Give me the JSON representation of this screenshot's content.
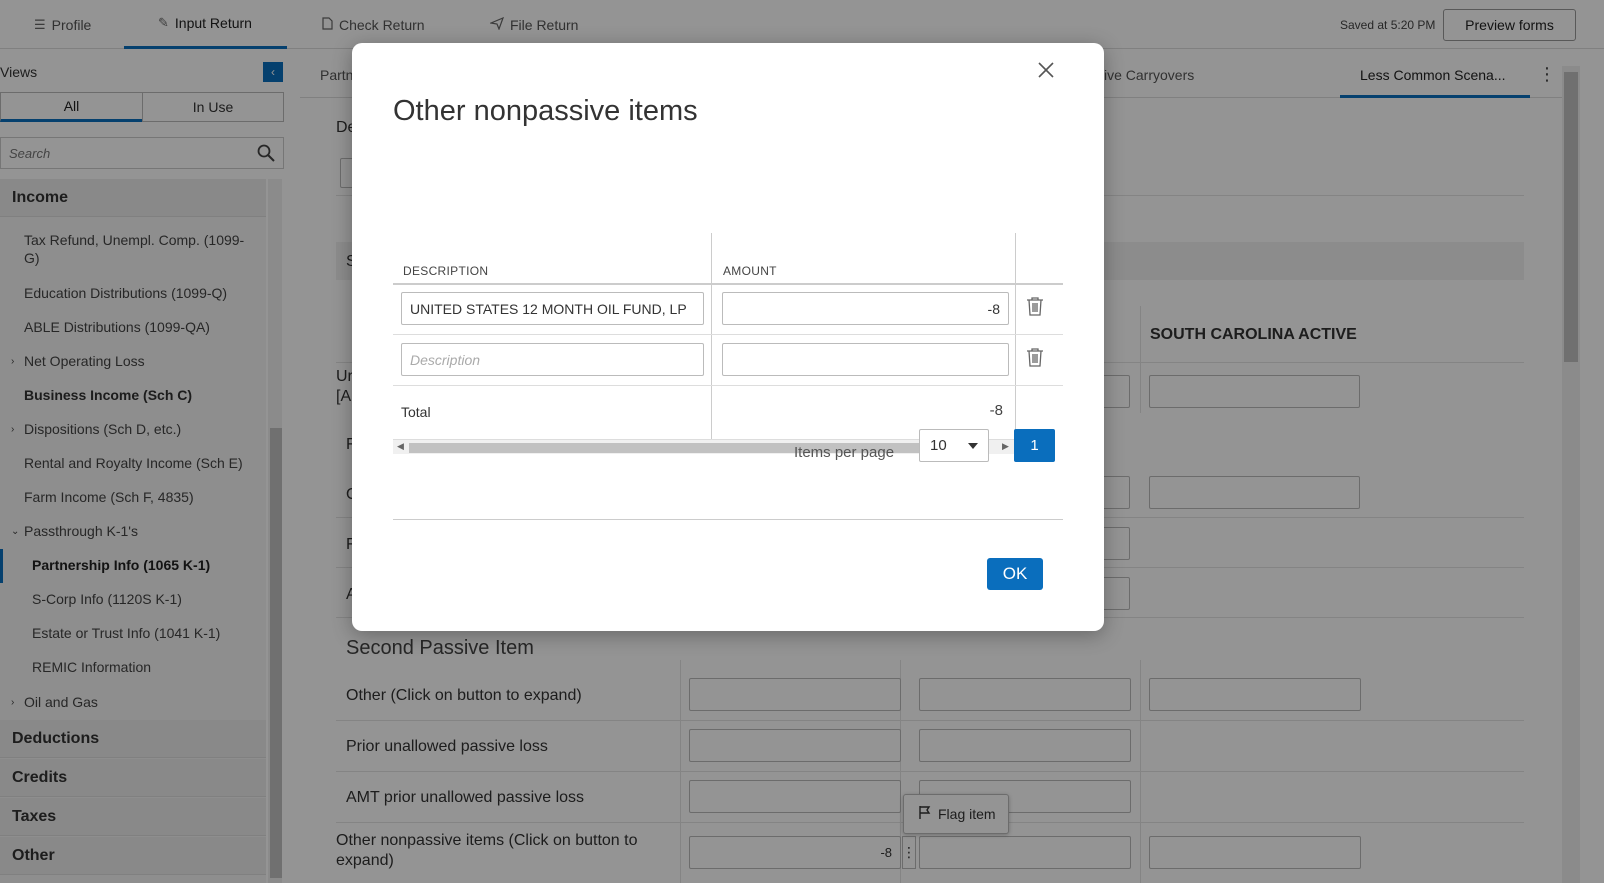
{
  "topnav": {
    "tabs": [
      {
        "label": "Profile",
        "icon": "list-icon"
      },
      {
        "label": "Input Return",
        "icon": "pencil-icon"
      },
      {
        "label": "Check Return",
        "icon": "document-icon"
      },
      {
        "label": "File Return",
        "icon": "paper-plane-icon"
      }
    ],
    "saved_text": "Saved at 5:20 PM",
    "preview_label": "Preview forms"
  },
  "sidebar": {
    "views_label": "Views",
    "filter_all": "All",
    "filter_in_use": "In Use",
    "search_placeholder": "Search",
    "categories": {
      "income": "Income",
      "deductions": "Deductions",
      "credits": "Credits",
      "taxes": "Taxes",
      "other": "Other"
    },
    "items": [
      "Tax Refund, Unempl. Comp. (1099-G)",
      "Education Distributions (1099-Q)",
      "ABLE Distributions (1099-QA)",
      "Net Operating Loss",
      "Business Income (Sch C)",
      "Dispositions (Sch D, etc.)",
      "Rental and Royalty Income (Sch E)",
      "Farm Income (Sch F, 4835)",
      "Passthrough K-1's",
      "Oil and Gas"
    ],
    "subitems": [
      "Partnership Info (1065 K-1)",
      "S-Corp Info (1120S K-1)",
      "Estate or Trust Info (1041 K-1)",
      "REMIC Information"
    ]
  },
  "main": {
    "subtabs": {
      "first": "Partn",
      "carryovers": "ssive Carryovers",
      "less_common": "Less Common Scena..."
    },
    "frag_de": "De",
    "frag_s": "S",
    "frag_un": "Ur",
    "frag_a": "[A",
    "frag_r": "F",
    "frag_o": "O",
    "frag_f": "F",
    "frag_aa": "A",
    "column_header": "SOUTH CAROLINA ACTIVE",
    "section_title": "Second Passive Item",
    "rows": {
      "other": "Other (Click on button to expand)",
      "prior": "Prior unallowed passive loss",
      "amt": "AMT prior unallowed passive loss",
      "nonpassive_line1": "Other nonpassive items (Click on button to",
      "nonpassive_line2": "expand)"
    },
    "nonpassive_value": "-8",
    "flag_label": "Flag item"
  },
  "modal": {
    "title": "Other nonpassive items",
    "headers": {
      "description": "DESCRIPTION",
      "amount": "AMOUNT"
    },
    "rows": [
      {
        "description": "UNITED STATES 12 MONTH OIL FUND, LP",
        "amount": "-8"
      },
      {
        "description": "",
        "amount": ""
      }
    ],
    "description_placeholder": "Description",
    "total_label": "Total",
    "total_value": "-8",
    "items_per_page_label": "Items per page",
    "items_per_page_value": "10",
    "page_number": "1",
    "ok_label": "OK"
  }
}
